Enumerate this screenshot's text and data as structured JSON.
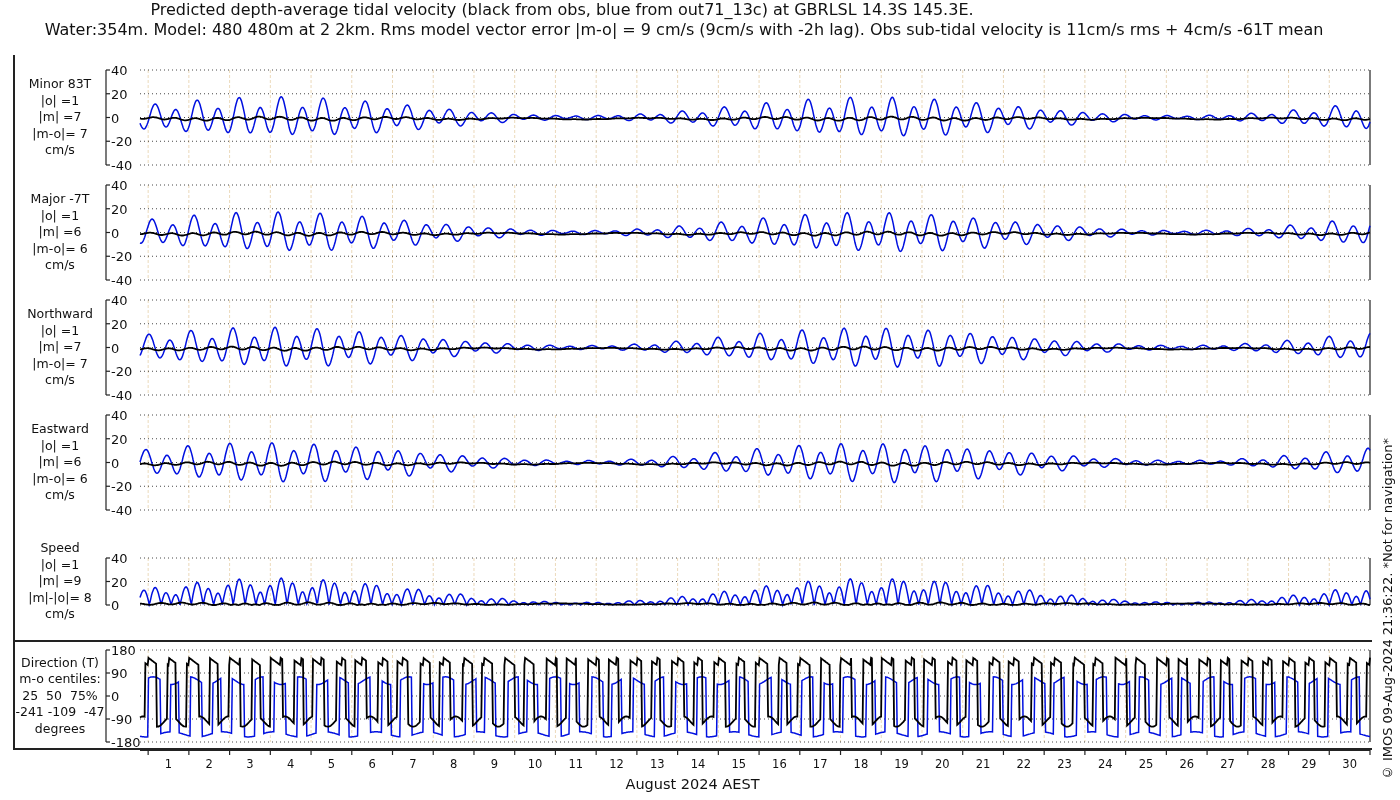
{
  "title_lines": [
    "Predicted depth-average tidal velocity (black from obs, blue from out71_13c) at GBRLSL 14.3S 145.3E.",
    "Water:354m. Model: 480 480m at 2 2km. Rms model vector error |m-o| = 9 cm/s (9cm/s with -2h lag). Obs sub-tidal velocity is 11cm/s rms + 4cm/s -61T mean"
  ],
  "panels": [
    {
      "kind": "signed",
      "label_lines": [
        "Minor 83T",
        "|o| =1",
        "|m| =7",
        "|m-o|= 7",
        "cm/s"
      ],
      "yticks": [
        "40",
        "20",
        "0",
        "-20",
        "-40"
      ]
    },
    {
      "kind": "signed",
      "label_lines": [
        "Major -7T",
        "|o| =1",
        "|m| =6",
        "|m-o|= 6",
        "cm/s"
      ],
      "yticks": [
        "40",
        "20",
        "0",
        "-20",
        "-40"
      ]
    },
    {
      "kind": "signed",
      "label_lines": [
        "Northward",
        "|o| =1",
        "|m| =7",
        "|m-o|= 7",
        "cm/s"
      ],
      "yticks": [
        "40",
        "20",
        "0",
        "-20",
        "-40"
      ]
    },
    {
      "kind": "signed",
      "label_lines": [
        "Eastward",
        "|o| =1",
        "|m| =6",
        "|m-o|= 6",
        "cm/s"
      ],
      "yticks": [
        "40",
        "20",
        "0",
        "-20",
        "-40"
      ]
    },
    {
      "kind": "speed",
      "label_lines": [
        "Speed",
        "|o| =1",
        "|m| =9",
        "|m|-|o|= 8",
        "cm/s"
      ],
      "yticks": [
        "40",
        "20",
        "0"
      ]
    },
    {
      "kind": "direction",
      "label_lines": [
        "Direction (T)",
        "m-o centiles:",
        "25  50  75%",
        "-241 -109  -47",
        "degrees"
      ],
      "yticks": [
        "180",
        "90",
        "0",
        "-90",
        "-180"
      ]
    }
  ],
  "xticks": [
    "1",
    "2",
    "3",
    "4",
    "5",
    "6",
    "7",
    "8",
    "9",
    "10",
    "11",
    "12",
    "13",
    "14",
    "15",
    "16",
    "17",
    "18",
    "19",
    "20",
    "21",
    "22",
    "23",
    "24",
    "25",
    "26",
    "27",
    "28",
    "29",
    "30"
  ],
  "xlabel": "August 2024 AEST",
  "credit": "© IMOS 09-Aug-2024 21:36:22. *Not for navigation*"
}
